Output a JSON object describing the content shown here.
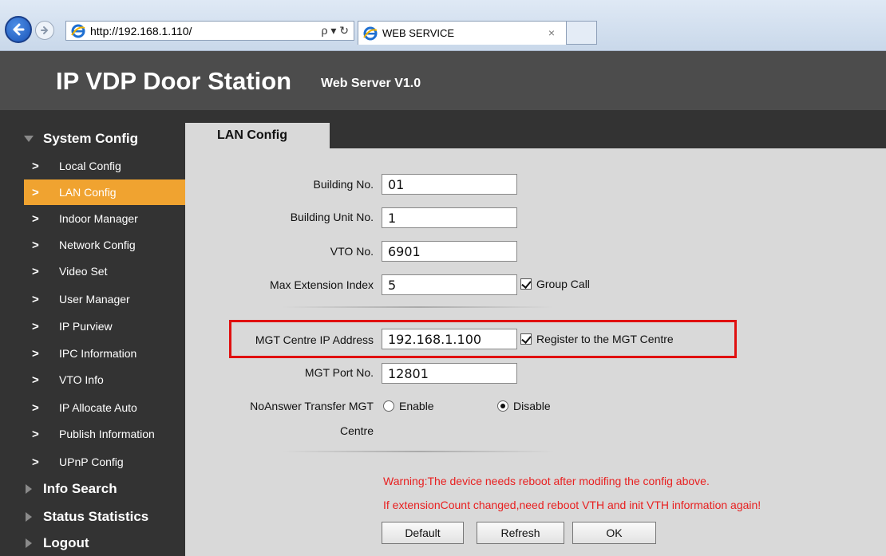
{
  "browser": {
    "url": "http://192.168.1.110/",
    "addr_controls": "ρ ▾ ↻",
    "tab_title": "WEB SERVICE",
    "tab_close": "×"
  },
  "header": {
    "title": "IP VDP Door Station",
    "subtitle": "Web Server V1.0"
  },
  "sidebar": {
    "sections": {
      "system_config": "System Config",
      "info_search": "Info Search",
      "status_statistics": "Status Statistics",
      "logout": "Logout"
    },
    "items": [
      {
        "label": "Local Config"
      },
      {
        "label": "LAN Config",
        "active": true
      },
      {
        "label": "Indoor Manager"
      },
      {
        "label": "Network Config"
      },
      {
        "label": "Video Set"
      },
      {
        "label": "User Manager"
      },
      {
        "label": "IP Purview"
      },
      {
        "label": "IPC Information"
      },
      {
        "label": "VTO Info"
      },
      {
        "label": "IP Allocate Auto"
      },
      {
        "label": "Publish Information"
      },
      {
        "label": "UPnP Config"
      }
    ],
    "chevron": ">"
  },
  "content": {
    "tab": "LAN Config",
    "form": {
      "building_no": {
        "label": "Building No.",
        "value": "01"
      },
      "building_unit_no": {
        "label": "Building Unit No.",
        "value": "1"
      },
      "vto_no": {
        "label": "VTO No.",
        "value": "6901"
      },
      "max_extension_index": {
        "label": "Max Extension Index",
        "value": "5"
      },
      "group_call": {
        "label": "Group Call",
        "checked": true
      },
      "mgt_ip": {
        "label": "MGT Centre IP Address",
        "value": "192.168.1.100"
      },
      "register_mgt": {
        "label": "Register to the MGT Centre",
        "checked": true
      },
      "mgt_port": {
        "label": "MGT Port No.",
        "value": "12801"
      },
      "noanswer_transfer": {
        "label_line1": "NoAnswer Transfer MGT",
        "label_line2": "Centre",
        "enable": "Enable",
        "disable": "Disable",
        "selected": "Disable"
      }
    },
    "warnings": [
      "Warning:The device needs reboot after modifing the config above.",
      "If extensionCount changed,need reboot VTH and init VTH information again!"
    ],
    "buttons": {
      "default": "Default",
      "refresh": "Refresh",
      "ok": "OK"
    }
  },
  "colors": {
    "header_bg": "#4c4c4c",
    "sidebar_bg": "#333333",
    "active_item": "#f0a330",
    "content_bg": "#d9d9d9",
    "warning_text": "#e82020",
    "highlight_box": "#e01010"
  }
}
